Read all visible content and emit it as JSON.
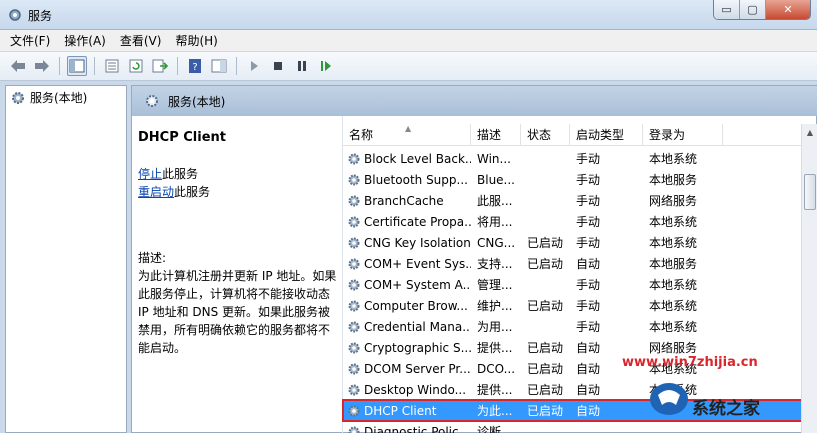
{
  "window": {
    "title": "服务",
    "minimize": "▭",
    "maximize": "▢",
    "close": "✕"
  },
  "menu": [
    {
      "label": "文件(F)"
    },
    {
      "label": "操作(A)"
    },
    {
      "label": "查看(V)"
    },
    {
      "label": "帮助(H)"
    }
  ],
  "tree": {
    "root_label": "服务(本地)"
  },
  "content": {
    "header": "服务(本地)",
    "selected_service": "DHCP Client",
    "stop_link": "停止",
    "stop_suffix": "此服务",
    "restart_link": "重启动",
    "restart_suffix": "此服务",
    "desc_label": "描述:",
    "desc_text": "为此计算机注册并更新 IP 地址。如果此服务停止，计算机将不能接收动态 IP 地址和 DNS 更新。如果此服务被禁用，所有明确依赖它的服务都将不能启动。"
  },
  "columns": {
    "name": "名称",
    "desc": "描述",
    "status": "状态",
    "startup": "启动类型",
    "logon": "登录为"
  },
  "services": [
    {
      "name": "Block Level Back...",
      "desc": "Win...",
      "status": "",
      "startup": "手动",
      "logon": "本地系统"
    },
    {
      "name": "Bluetooth Supp...",
      "desc": "Blue...",
      "status": "",
      "startup": "手动",
      "logon": "本地服务"
    },
    {
      "name": "BranchCache",
      "desc": "此服...",
      "status": "",
      "startup": "手动",
      "logon": "网络服务"
    },
    {
      "name": "Certificate Propa...",
      "desc": "将用...",
      "status": "",
      "startup": "手动",
      "logon": "本地系统"
    },
    {
      "name": "CNG Key Isolation",
      "desc": "CNG...",
      "status": "已启动",
      "startup": "手动",
      "logon": "本地系统"
    },
    {
      "name": "COM+ Event Sys...",
      "desc": "支持...",
      "status": "已启动",
      "startup": "自动",
      "logon": "本地服务"
    },
    {
      "name": "COM+ System A...",
      "desc": "管理...",
      "status": "",
      "startup": "手动",
      "logon": "本地系统"
    },
    {
      "name": "Computer Brow...",
      "desc": "维护...",
      "status": "已启动",
      "startup": "手动",
      "logon": "本地系统"
    },
    {
      "name": "Credential Mana...",
      "desc": "为用...",
      "status": "",
      "startup": "手动",
      "logon": "本地系统"
    },
    {
      "name": "Cryptographic S...",
      "desc": "提供...",
      "status": "已启动",
      "startup": "自动",
      "logon": "网络服务"
    },
    {
      "name": "DCOM Server Pr...",
      "desc": "DCO...",
      "status": "已启动",
      "startup": "自动",
      "logon": "本地系统"
    },
    {
      "name": "Desktop Windo...",
      "desc": "提供...",
      "status": "已启动",
      "startup": "自动",
      "logon": "本地系统"
    },
    {
      "name": "DHCP Client",
      "desc": "为此...",
      "status": "已启动",
      "startup": "自动",
      "logon": ""
    },
    {
      "name": "Diagnostic Polic...",
      "desc": "诊断...",
      "status": "",
      "startup": "",
      "logon": ""
    }
  ],
  "selected_index": 12,
  "watermark": {
    "url": "www.win7zhijia.cn",
    "brand": "系统之家"
  },
  "colors": {
    "selection": "#3399ff",
    "highlight_border": "#d9262c",
    "header_bg": "#b4c8de"
  }
}
